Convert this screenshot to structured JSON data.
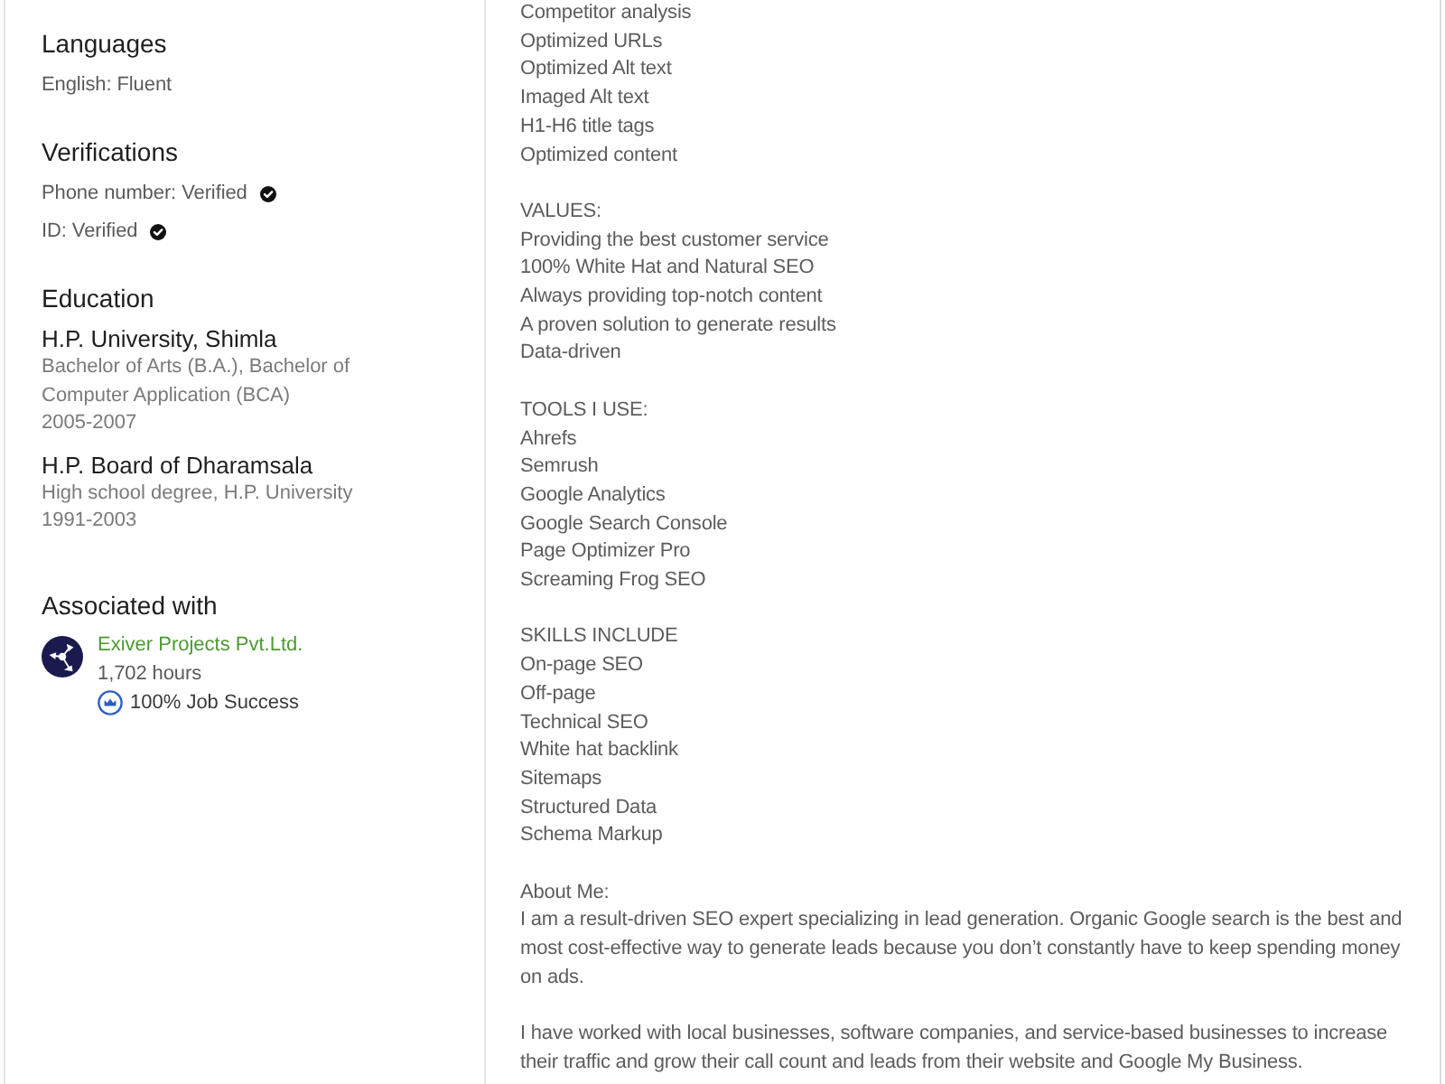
{
  "sidebar": {
    "languages": {
      "title": "Languages",
      "items": [
        "English: Fluent"
      ]
    },
    "verifications": {
      "title": "Verifications",
      "items": [
        {
          "label": "Phone number: Verified",
          "verified": true
        },
        {
          "label": "ID: Verified",
          "verified": true
        }
      ]
    },
    "education": {
      "title": "Education",
      "entries": [
        {
          "school": "H.P. University, Shimla",
          "degree": "Bachelor of Arts (B.A.), Bachelor of Computer Application (BCA)",
          "years": "2005-2007"
        },
        {
          "school": "H.P. Board of Dharamsala",
          "degree": "High school degree, H.P. University",
          "years": "1991-2003"
        }
      ]
    },
    "associated": {
      "title": "Associated with",
      "agencies": [
        {
          "name": "Exiver Projects Pvt.Ltd.",
          "hours": "1,702 hours",
          "job_success": "100% Job Success"
        }
      ]
    }
  },
  "description": [
    {
      "kind": "list",
      "items": [
        "Competitor analysis",
        "Optimized URLs",
        "Optimized Alt text",
        "Imaged Alt text",
        "H1-H6 title tags",
        "Optimized content"
      ]
    },
    {
      "kind": "list",
      "heading": "VALUES:",
      "items": [
        "Providing the best customer service",
        "100% White Hat and Natural SEO",
        "Always providing top-notch content",
        "A proven solution to generate results",
        "Data-driven"
      ]
    },
    {
      "kind": "list",
      "heading": "TOOLS I USE:",
      "items": [
        "Ahrefs",
        "Semrush",
        "Google Analytics",
        "Google Search Console",
        "Page Optimizer Pro",
        "Screaming Frog SEO"
      ]
    },
    {
      "kind": "list",
      "heading": "SKILLS INCLUDE",
      "items": [
        "On-page SEO",
        "Off-page",
        "Technical SEO",
        "White hat backlink",
        "Sitemaps",
        "Structured Data",
        "Schema Markup"
      ]
    },
    {
      "kind": "text",
      "heading": "About Me:",
      "paragraph": "I am a result-driven SEO expert specializing in lead generation. Organic Google search is the best and most cost-effective way to generate leads because you don’t constantly have to keep spending money on ads."
    },
    {
      "kind": "text",
      "paragraph": "I have worked with local businesses, software companies, and service-based businesses to increase their traffic and grow their call count and leads from their website and Google My Business."
    }
  ]
}
